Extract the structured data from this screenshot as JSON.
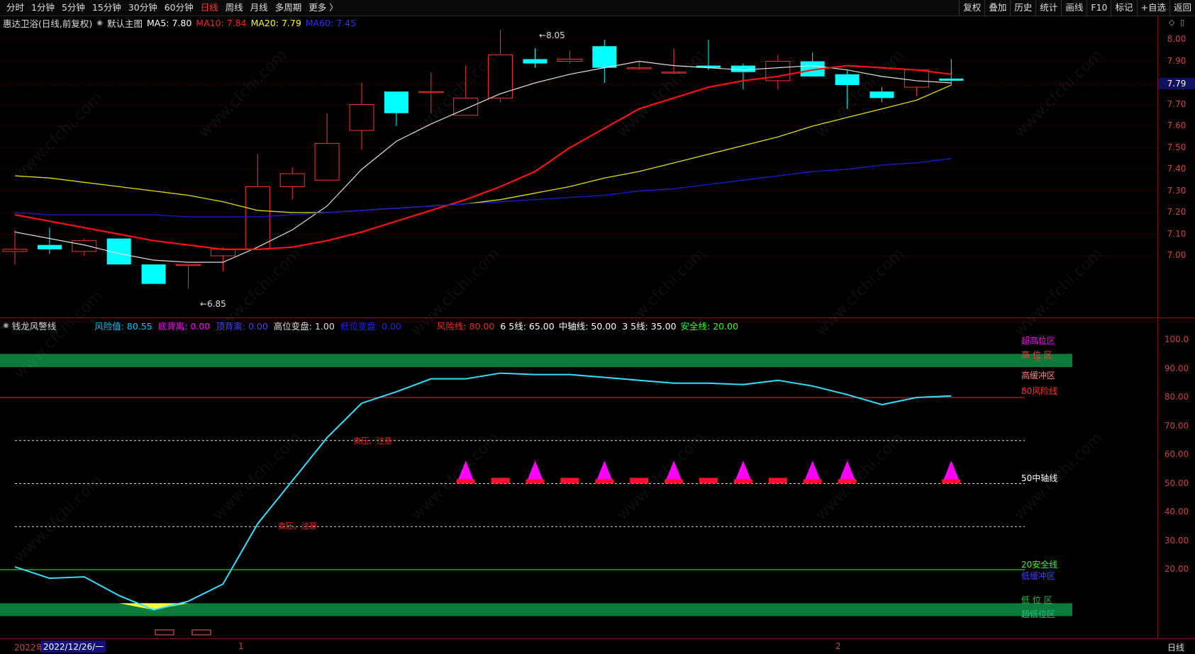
{
  "toolbar": {
    "periods": [
      {
        "label": "分时",
        "active": false
      },
      {
        "label": "1分钟",
        "active": false
      },
      {
        "label": "5分钟",
        "active": false
      },
      {
        "label": "15分钟",
        "active": false
      },
      {
        "label": "30分钟",
        "active": false
      },
      {
        "label": "60分钟",
        "active": false
      },
      {
        "label": "日线",
        "active": true
      },
      {
        "label": "周线",
        "active": false
      },
      {
        "label": "月线",
        "active": false
      },
      {
        "label": "多周期",
        "active": false
      },
      {
        "label": "更多 〉",
        "active": false
      }
    ],
    "actions": [
      "复权",
      "叠加",
      "历史",
      "统计",
      "画线",
      "F10",
      "标记",
      "+自选",
      "返回"
    ]
  },
  "main": {
    "stock": "惠达卫浴(日线,前复权)",
    "chart_name": "默认主图",
    "ma": [
      {
        "label": "MA5: 7.80",
        "color": "#ffffff"
      },
      {
        "label": "MA10: 7.84",
        "color": "#ff2020"
      },
      {
        "label": "MA20: 7.79",
        "color": "#ffff00"
      },
      {
        "label": "MA60: 7.45",
        "color": "#2020ff"
      }
    ],
    "high_mark": "8.05",
    "low_mark": "6.85",
    "last_price": "7.79",
    "yaxis_labels": [
      "8.00",
      "7.90",
      "7.80",
      "7.70",
      "7.60",
      "7.50",
      "7.40",
      "7.30",
      "7.20",
      "7.10",
      "7.00"
    ]
  },
  "sub": {
    "name": "钱龙风警线",
    "params": [
      {
        "label": "风险值: 80.55",
        "color": "#00c0ff"
      },
      {
        "label": "底背离: 0.00",
        "color": "#ff00ff"
      },
      {
        "label": "顶背离: 0.00",
        "color": "#4040ff"
      },
      {
        "label": "高位变盘: 1.00",
        "color": "#dddddd"
      },
      {
        "label": "低位变盘: 0.00",
        "color": "#2020ff"
      },
      {
        "label": "风险线: 80.00",
        "color": "#ff2020"
      },
      {
        "label": "6 5线: 65.00",
        "color": "#ffffff"
      },
      {
        "label": "中轴线: 50.00",
        "color": "#ffffff"
      },
      {
        "label": "3 5线: 35.00",
        "color": "#ffffff"
      },
      {
        "label": "安全线: 20.00",
        "color": "#20ff20"
      }
    ],
    "yaxis_labels": [
      "100.0",
      "90.00",
      "80.00",
      "70.00",
      "60.00",
      "50.00",
      "40.00",
      "30.00",
      "20.00"
    ],
    "zones": [
      {
        "label": "超高位区",
        "color": "#ff00ff"
      },
      {
        "label": "高 位 区",
        "color": "#ff4040"
      },
      {
        "label": "高缓冲区",
        "color": "#ff8080"
      },
      {
        "label": "80风险线",
        "color": "#ff3030"
      },
      {
        "label": "50中轴线",
        "color": "#ffffff"
      },
      {
        "label": "20安全线",
        "color": "#20ff20"
      },
      {
        "label": "低缓冲区",
        "color": "#4040ff"
      },
      {
        "label": "低 位 区",
        "color": "#20c040"
      },
      {
        "label": "超低位区",
        "color": "#20c080"
      }
    ],
    "annot1": "卖压、注意",
    "annot2": "卖压、注意"
  },
  "footer": {
    "year": "2022年",
    "date": "2022/12/26/一",
    "m1": "1",
    "m2": "2",
    "period": "日线"
  },
  "watermark": "www.cfchi.com",
  "chart_data": [
    {
      "type": "candlestick",
      "title": "惠达卫浴(日线,前复权)",
      "ylim": [
        6.85,
        8.05
      ],
      "candles": [
        {
          "o": 7.02,
          "h": 7.12,
          "l": 6.96,
          "c": 7.03
        },
        {
          "o": 7.05,
          "h": 7.13,
          "l": 7.01,
          "c": 7.03
        },
        {
          "o": 7.02,
          "h": 7.08,
          "l": 7.0,
          "c": 7.07
        },
        {
          "o": 7.08,
          "h": 7.08,
          "l": 6.96,
          "c": 6.96
        },
        {
          "o": 6.96,
          "h": 6.96,
          "l": 6.87,
          "c": 6.87
        },
        {
          "o": 6.96,
          "h": 6.96,
          "l": 6.85,
          "c": 6.96
        },
        {
          "o": 7.0,
          "h": 7.04,
          "l": 6.93,
          "c": 7.03
        },
        {
          "o": 7.03,
          "h": 7.47,
          "l": 7.03,
          "c": 7.32
        },
        {
          "o": 7.32,
          "h": 7.41,
          "l": 7.26,
          "c": 7.38
        },
        {
          "o": 7.35,
          "h": 7.66,
          "l": 7.35,
          "c": 7.52
        },
        {
          "o": 7.58,
          "h": 7.8,
          "l": 7.49,
          "c": 7.7
        },
        {
          "o": 7.76,
          "h": 7.76,
          "l": 7.6,
          "c": 7.66
        },
        {
          "o": 7.76,
          "h": 7.85,
          "l": 7.66,
          "c": 7.76
        },
        {
          "o": 7.65,
          "h": 7.88,
          "l": 7.65,
          "c": 7.73
        },
        {
          "o": 7.73,
          "h": 8.05,
          "l": 7.71,
          "c": 7.93
        },
        {
          "o": 7.91,
          "h": 7.96,
          "l": 7.87,
          "c": 7.89
        },
        {
          "o": 7.9,
          "h": 7.95,
          "l": 7.89,
          "c": 7.91
        },
        {
          "o": 7.97,
          "h": 8.0,
          "l": 7.8,
          "c": 7.87
        },
        {
          "o": 7.87,
          "h": 7.9,
          "l": 7.86,
          "c": 7.87
        },
        {
          "o": 7.85,
          "h": 7.96,
          "l": 7.84,
          "c": 7.85
        },
        {
          "o": 7.88,
          "h": 8.0,
          "l": 7.86,
          "c": 7.87
        },
        {
          "o": 7.88,
          "h": 7.89,
          "l": 7.77,
          "c": 7.85
        },
        {
          "o": 7.81,
          "h": 7.93,
          "l": 7.77,
          "c": 7.9
        },
        {
          "o": 7.9,
          "h": 7.94,
          "l": 7.83,
          "c": 7.83
        },
        {
          "o": 7.84,
          "h": 7.86,
          "l": 7.68,
          "c": 7.79
        },
        {
          "o": 7.76,
          "h": 7.78,
          "l": 7.71,
          "c": 7.73
        },
        {
          "o": 7.78,
          "h": 7.86,
          "l": 7.74,
          "c": 7.86
        },
        {
          "o": 7.82,
          "h": 7.91,
          "l": 7.79,
          "c": 7.81
        }
      ],
      "series": [
        {
          "name": "MA5",
          "values": [
            7.11,
            7.08,
            7.05,
            7.01,
            6.98,
            6.97,
            6.97,
            7.04,
            7.12,
            7.23,
            7.4,
            7.53,
            7.61,
            7.68,
            7.75,
            7.8,
            7.84,
            7.87,
            7.9,
            7.88,
            7.87,
            7.86,
            7.87,
            7.88,
            7.86,
            7.83,
            7.81,
            7.8
          ]
        },
        {
          "name": "MA10",
          "values": [
            7.19,
            7.16,
            7.13,
            7.1,
            7.07,
            7.05,
            7.03,
            7.03,
            7.04,
            7.07,
            7.11,
            7.16,
            7.21,
            7.26,
            7.32,
            7.39,
            7.5,
            7.59,
            7.68,
            7.73,
            7.78,
            7.81,
            7.83,
            7.86,
            7.88,
            7.87,
            7.86,
            7.84
          ]
        },
        {
          "name": "MA20",
          "values": [
            7.37,
            7.36,
            7.34,
            7.32,
            7.3,
            7.28,
            7.25,
            7.21,
            7.2,
            7.2,
            7.21,
            7.22,
            7.23,
            7.24,
            7.26,
            7.29,
            7.32,
            7.36,
            7.39,
            7.43,
            7.47,
            7.51,
            7.55,
            7.6,
            7.64,
            7.68,
            7.72,
            7.79
          ]
        },
        {
          "name": "MA60",
          "values": [
            7.2,
            7.19,
            7.19,
            7.19,
            7.19,
            7.18,
            7.18,
            7.18,
            7.19,
            7.2,
            7.21,
            7.22,
            7.23,
            7.24,
            7.25,
            7.26,
            7.27,
            7.28,
            7.3,
            7.31,
            7.33,
            7.35,
            7.37,
            7.39,
            7.4,
            7.42,
            7.43,
            7.45
          ]
        }
      ]
    },
    {
      "type": "line",
      "title": "钱龙风警线",
      "ylim": [
        0,
        100
      ],
      "series": [
        {
          "name": "风险值",
          "values": [
            21,
            17,
            17.5,
            11,
            6,
            9,
            15,
            36,
            51,
            66,
            78,
            82,
            86.5,
            86.5,
            88.5,
            88,
            88,
            87,
            86,
            85,
            85,
            84.5,
            86,
            84,
            81,
            77.5,
            80,
            80.55
          ]
        }
      ],
      "marks": [
        {
          "index": 13,
          "kind": "triangle"
        },
        {
          "index": 14,
          "kind": "bar"
        },
        {
          "index": 15,
          "kind": "triangle"
        },
        {
          "index": 16,
          "kind": "bar"
        },
        {
          "index": 17,
          "kind": "triangle"
        },
        {
          "index": 18,
          "kind": "bar"
        },
        {
          "index": 19,
          "kind": "triangle"
        },
        {
          "index": 20,
          "kind": "bar"
        },
        {
          "index": 21,
          "kind": "triangle"
        },
        {
          "index": 22,
          "kind": "bar"
        },
        {
          "index": 23,
          "kind": "triangle"
        },
        {
          "index": 24,
          "kind": "triangle"
        },
        {
          "index": 27,
          "kind": "triangle"
        }
      ],
      "hlines": [
        80,
        65,
        50,
        35,
        20
      ]
    }
  ]
}
